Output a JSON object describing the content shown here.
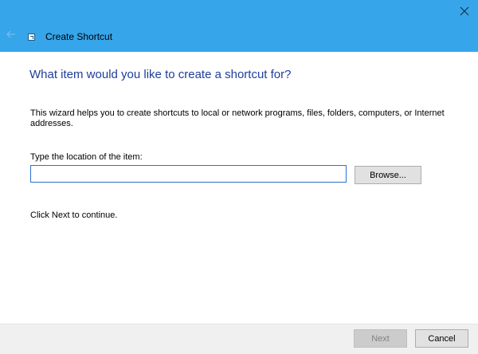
{
  "window": {
    "title": "Create Shortcut",
    "titlebar_color": "#37a5ea"
  },
  "icons": {
    "close": "close-icon",
    "back": "back-arrow-icon",
    "app": "shortcut-wizard-icon"
  },
  "page": {
    "heading": "What item would you like to create a shortcut for?",
    "heading_color": "#1e3e9a",
    "description": "This wizard helps you to create shortcuts to local or network programs, files, folders, computers, or Internet addresses.",
    "field_label": "Type the location of the item:",
    "location_value": "",
    "location_placeholder": "",
    "continue_text": "Click Next to continue."
  },
  "buttons": {
    "browse": "Browse...",
    "next": "Next",
    "cancel": "Cancel"
  }
}
